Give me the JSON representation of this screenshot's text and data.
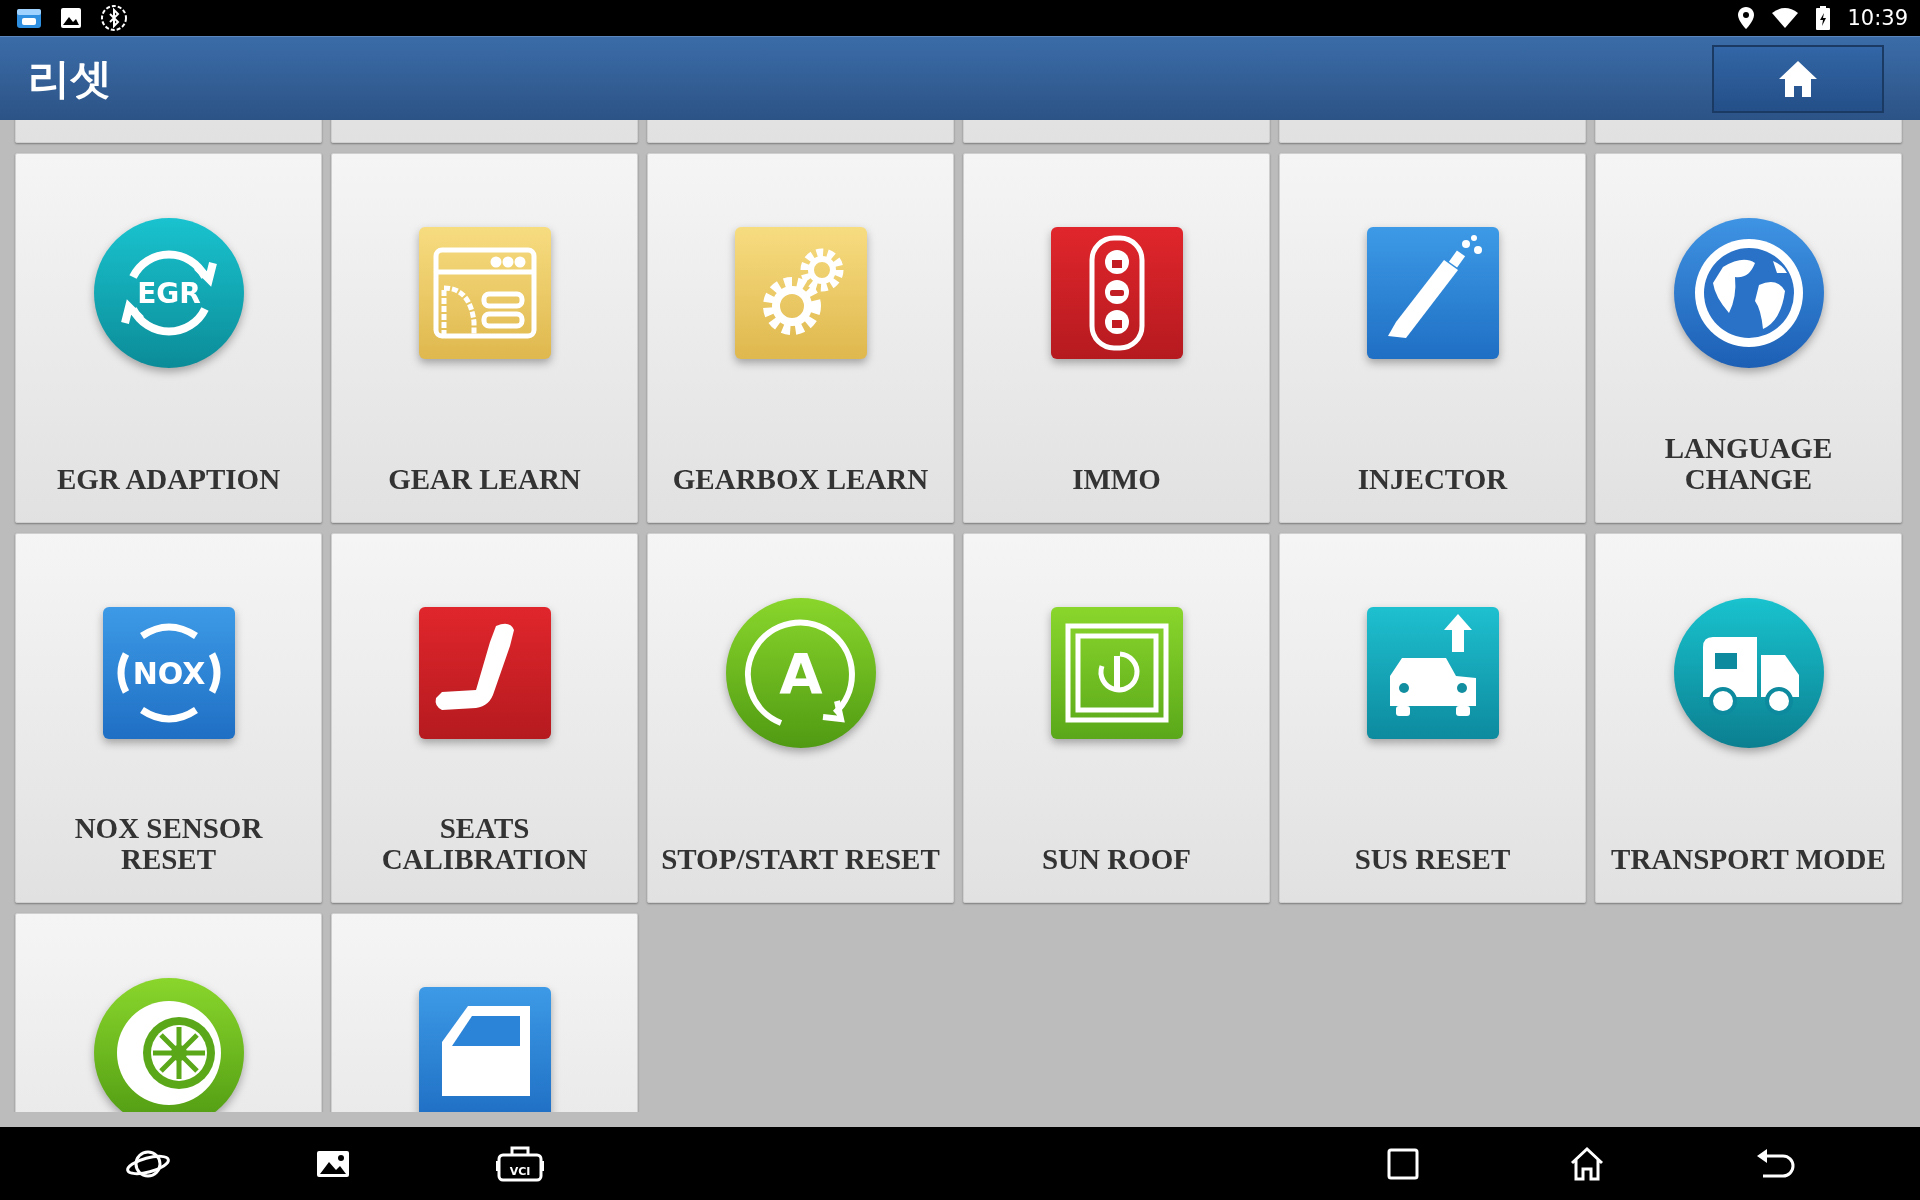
{
  "status_bar": {
    "time": "10:39"
  },
  "header": {
    "title": "리셋"
  },
  "tiles": [
    {
      "kind": "egr",
      "icon_text": "EGR",
      "label_lines": [
        "EGR ADAPTION"
      ]
    },
    {
      "kind": "gear-learn",
      "label_lines": [
        "GEAR LEARN"
      ]
    },
    {
      "kind": "gearbox",
      "label_lines": [
        "GEARBOX LEARN"
      ]
    },
    {
      "kind": "immo",
      "label_lines": [
        "IMMO"
      ]
    },
    {
      "kind": "injector",
      "label_lines": [
        "INJECTOR"
      ]
    },
    {
      "kind": "language",
      "label_lines": [
        "LANGUAGE",
        "CHANGE"
      ]
    },
    {
      "kind": "nox",
      "icon_text": "NOX",
      "label_lines": [
        "NOX SENSOR",
        "RESET"
      ]
    },
    {
      "kind": "seat",
      "label_lines": [
        "SEATS",
        "CALIBRATION"
      ]
    },
    {
      "kind": "stopstart",
      "icon_text": "A",
      "label_lines": [
        "STOP/START RESET"
      ]
    },
    {
      "kind": "sunroof",
      "label_lines": [
        "SUN ROOF"
      ]
    },
    {
      "kind": "sus",
      "label_lines": [
        "SUS RESET"
      ]
    },
    {
      "kind": "transport",
      "label_lines": [
        "TRANSPORT MODE"
      ]
    },
    {
      "kind": "wheel"
    },
    {
      "kind": "door"
    }
  ],
  "nav_bar": {
    "vci_label": "VCI"
  }
}
